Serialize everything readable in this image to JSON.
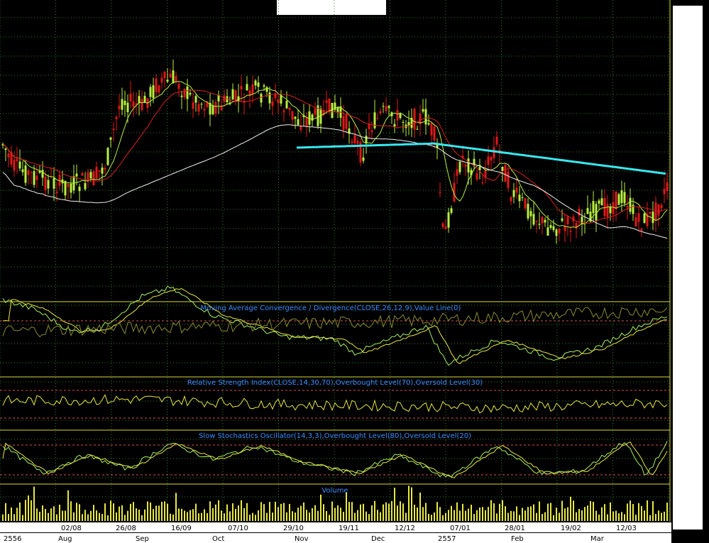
{
  "colors": {
    "background": "#000000",
    "grid": "#2e7d2e",
    "panel_border": "#d8d838",
    "bull": "#b8f040",
    "bear": "#e01818",
    "ma_short": "#ffffff",
    "ma_mid": "#d82020",
    "ma_long_white": "#f0f0f0",
    "ma_cyan": "#38e8f0",
    "signal_yellow": "#e8e840",
    "signal_green": "#a8f060",
    "ref_level": "#d85050",
    "volume": "#e8e840",
    "label_text": "#3c8cff",
    "date_bar": "#ffffff"
  },
  "panels": {
    "macd_title": "Moving Average Convergence / Divergence(CLOSE,26,12,9),Value Line(0)",
    "rsi_title": "Relative Strength Index(CLOSE,14,30,70),Overbought Level(70),Oversold Level(30)",
    "stoch_title": "Slow Stochastics Oscillator(14,3,3),Overbought Level(80),Oversold Level(20)",
    "volume_title": "Volume"
  },
  "x_axis": {
    "top_row": [
      "02/08",
      "26/08",
      "16/09",
      "07/10",
      "29/10",
      "19/11",
      "12/12",
      "07/01",
      "28/01",
      "19/02",
      "12/03"
    ],
    "bottom_row": [
      "2556",
      "Aug",
      "Sep",
      "Oct",
      "Nov",
      "Dec",
      "2557",
      "Feb",
      "Mar"
    ]
  },
  "chart_data": [
    {
      "type": "candlestick",
      "panel": "price",
      "series": [
        {
          "name": "",
          "role": "price"
        },
        {
          "name": "",
          "role": "moving-average-short"
        },
        {
          "name": "",
          "role": "moving-average-medium"
        },
        {
          "name": "",
          "role": "moving-average-long"
        },
        {
          "name": "",
          "role": "moving-average-very-long"
        }
      ]
    },
    {
      "type": "line",
      "title": "Moving Average Convergence / Divergence(CLOSE,26,12,9),Value Line(0)",
      "series": [
        {
          "name": "MACD"
        },
        {
          "name": "Signal"
        }
      ]
    },
    {
      "type": "line",
      "title": "Relative Strength Index(CLOSE,14,30,70),Overbought Level(70),Oversold Level(30)",
      "levels": [
        70,
        30
      ],
      "ylim": [
        0,
        100
      ]
    },
    {
      "type": "line",
      "title": "Slow Stochastics Oscillator(14,3,3),Overbought Level(80),Oversold Level(20)",
      "levels": [
        80,
        20
      ],
      "ylim": [
        0,
        100
      ]
    },
    {
      "type": "bar",
      "title": "Volume"
    }
  ]
}
